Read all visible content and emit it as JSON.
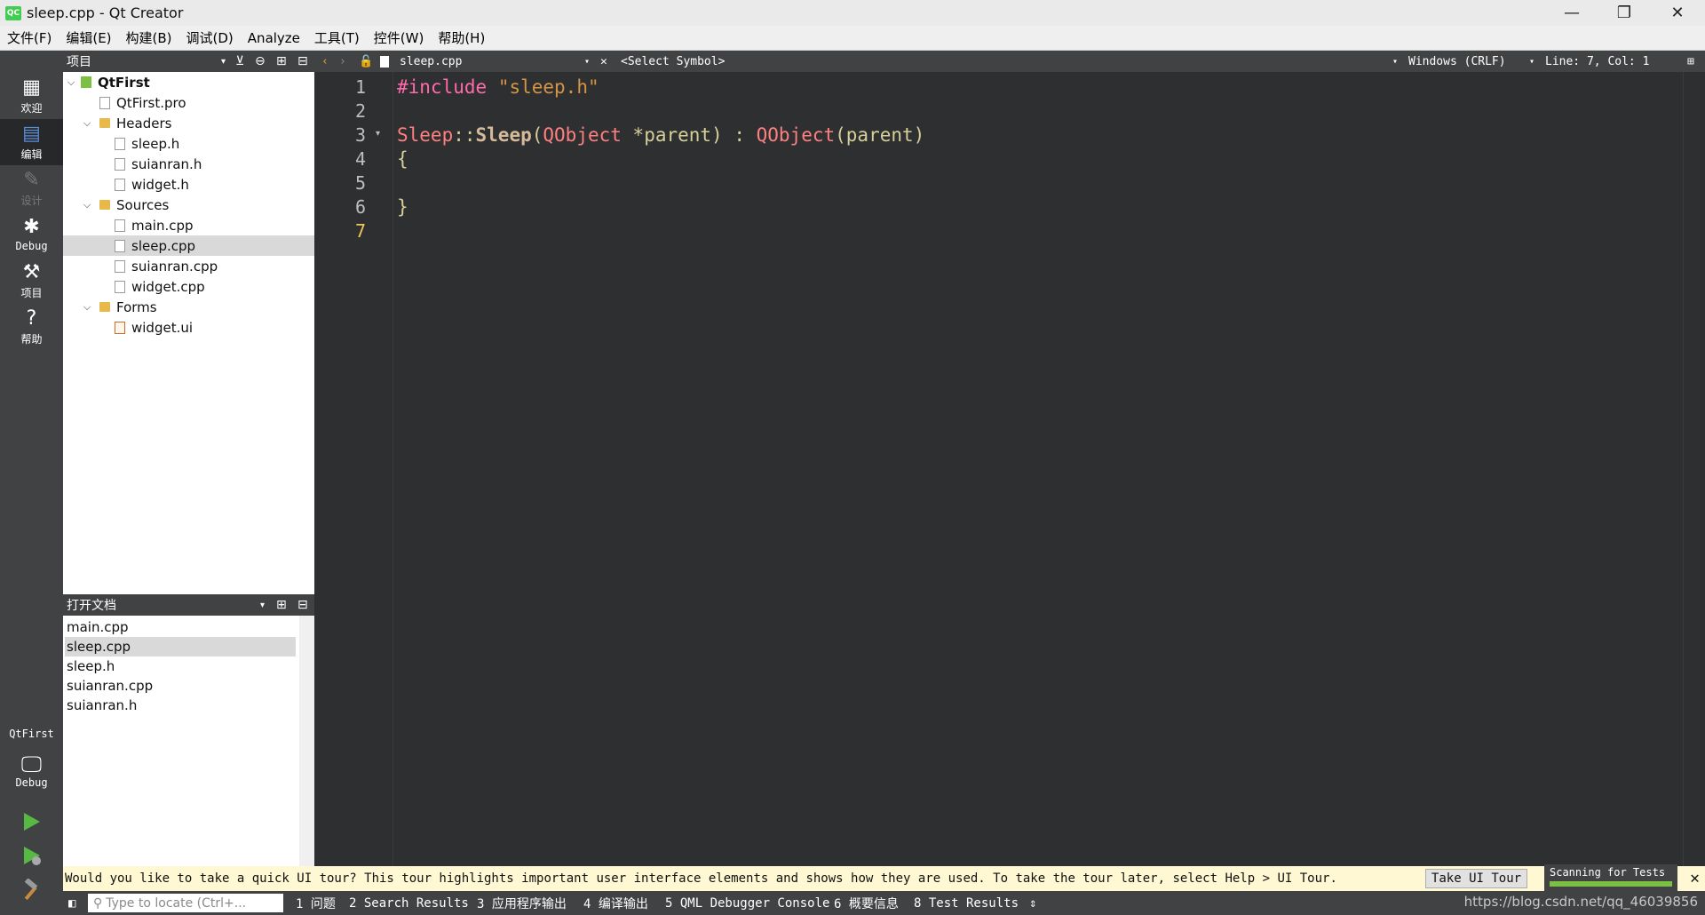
{
  "window": {
    "title": "sleep.cpp - Qt Creator",
    "app_icon": "QC",
    "minimize": "—",
    "restore": "❐",
    "close": "✕"
  },
  "menu": [
    "文件(F)",
    "编辑(E)",
    "构建(B)",
    "调试(D)",
    "Analyze",
    "工具(T)",
    "控件(W)",
    "帮助(H)"
  ],
  "modes": {
    "welcome": "欢迎",
    "edit": "编辑",
    "design": "设计",
    "debug": "Debug",
    "projects": "项目",
    "help": "帮助"
  },
  "kit": {
    "project": "QtFirst",
    "build": "Debug"
  },
  "project_panel": {
    "title": "项目",
    "tree": {
      "root": "QtFirst",
      "pro_file": "QtFirst.pro",
      "headers_label": "Headers",
      "headers": [
        "sleep.h",
        "suianran.h",
        "widget.h"
      ],
      "sources_label": "Sources",
      "sources": [
        "main.cpp",
        "sleep.cpp",
        "suianran.cpp",
        "widget.cpp"
      ],
      "forms_label": "Forms",
      "forms": [
        "widget.ui"
      ]
    }
  },
  "open_docs": {
    "title": "打开文档",
    "items": [
      "main.cpp",
      "sleep.cpp",
      "sleep.h",
      "suianran.cpp",
      "suianran.h"
    ]
  },
  "editor_toolbar": {
    "file": "sleep.cpp",
    "symbol": "<Select Symbol>",
    "line_ending": "Windows (CRLF)",
    "position": "Line: 7, Col: 1"
  },
  "code": {
    "line_numbers": [
      "1",
      "2",
      "3",
      "4",
      "5",
      "6",
      "7"
    ],
    "line1": {
      "directive": "#include",
      "string": "\"sleep.h\""
    },
    "line3": {
      "cls": "Sleep",
      "sep": "::",
      "fn": "Sleep",
      "p1": "(",
      "type": "QObject",
      "arg": " *parent) : ",
      "base": "QObject",
      "tail": "(parent)"
    },
    "line4": "{",
    "line6": "}"
  },
  "info_bar": {
    "message": "Would you like to take a quick UI tour? This tour highlights important user interface elements and shows how they are used. To take the tour later, select Help > UI Tour.",
    "button": "Take UI Tour",
    "progress_label": "Scanning for Tests"
  },
  "status_bar": {
    "locator_placeholder": "Type to locate (Ctrl+...",
    "panes": [
      "1 问题",
      "2 Search Results",
      "3 应用程序输出",
      "4 编译输出",
      "5 QML Debugger Console",
      "6 概要信息",
      "8 Test Results"
    ]
  },
  "watermark": "https://blog.csdn.net/qq_46039856"
}
